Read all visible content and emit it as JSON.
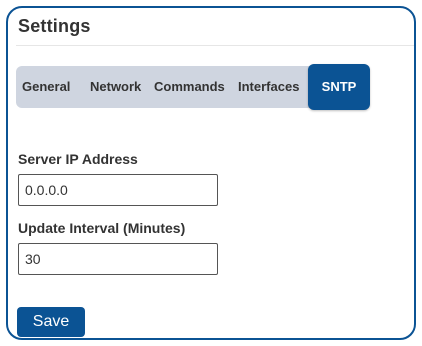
{
  "panel": {
    "title": "Settings"
  },
  "tabs": [
    {
      "label": "General",
      "active": false
    },
    {
      "label": "Network",
      "active": false
    },
    {
      "label": "Commands",
      "active": false
    },
    {
      "label": "Interfaces",
      "active": false
    },
    {
      "label": "SNTP",
      "active": true
    }
  ],
  "form": {
    "server_ip": {
      "label": "Server IP Address",
      "value": "0.0.0.0"
    },
    "update_interval": {
      "label": "Update Interval (Minutes)",
      "value": "30"
    },
    "save_label": "Save"
  },
  "colors": {
    "accent": "#0b5394",
    "tabbar_background": "#cfd5e0",
    "text": "#333333"
  }
}
